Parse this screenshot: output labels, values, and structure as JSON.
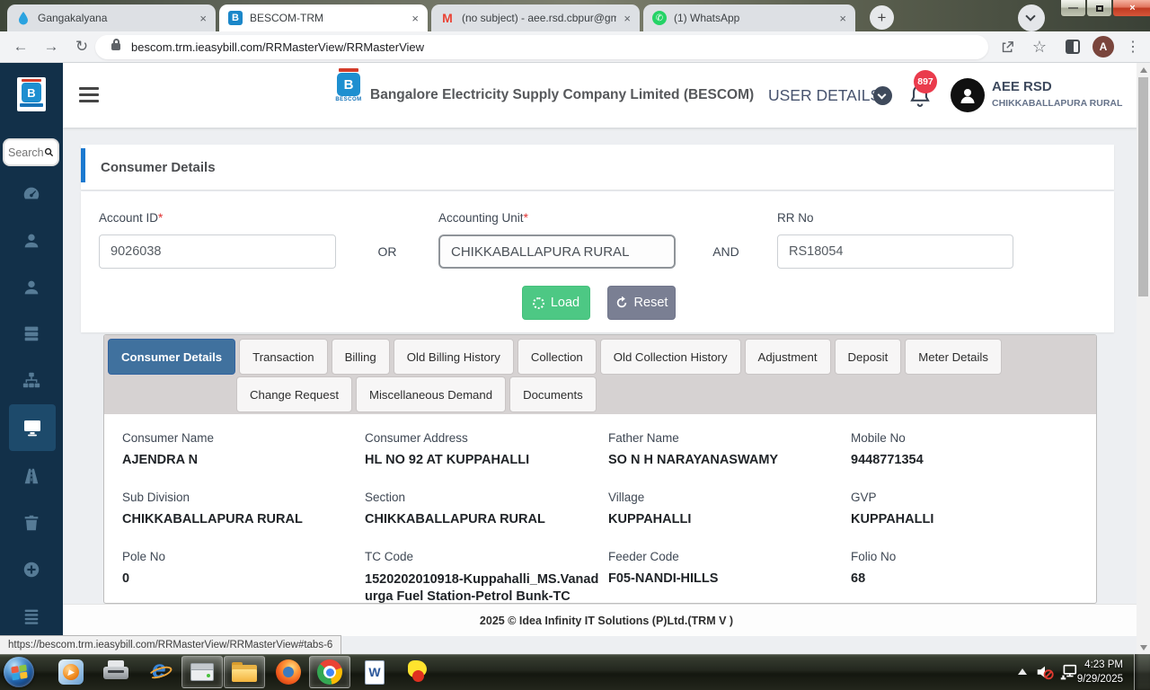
{
  "browser": {
    "tabs": [
      {
        "title": "Gangakalyana"
      },
      {
        "title": "BESCOM-TRM"
      },
      {
        "title": "(no subject) - aee.rsd.cbpur@gm"
      },
      {
        "title": "(1) WhatsApp"
      }
    ],
    "url": "bescom.trm.ieasybill.com/RRMasterView/RRMasterView",
    "profile_initial": "A"
  },
  "header": {
    "company_title": "Bangalore Electricity Supply Company Limited (BESCOM)",
    "logo_text": "BESCOM",
    "logo_letter": "B",
    "user_details_label": "USER DETAILS",
    "notification_count": "897",
    "user_name": "AEE RSD",
    "user_subtitle": "CHIKKABALLAPURA RURAL"
  },
  "sidebar": {
    "search_placeholder": "Search",
    "icons": [
      "dashboard",
      "user",
      "user",
      "server",
      "sitemap",
      "monitor",
      "road",
      "trash",
      "plus-circle",
      "list"
    ]
  },
  "page": {
    "title": "Consumer Details",
    "form": {
      "required_mark": "*",
      "account_id_label": "Account ID",
      "account_id_value": "9026038",
      "or_label": "OR",
      "accounting_unit_label": "Accounting Unit",
      "accounting_unit_value": "CHIKKABALLAPURA RURAL",
      "and_label": "AND",
      "rr_no_label": "RR No",
      "rr_no_value": "RS18054",
      "load_label": "Load",
      "reset_label": "Reset"
    },
    "tabs_row1": [
      "Consumer Details",
      "Transaction",
      "Billing",
      "Old Billing History",
      "Collection",
      "Old Collection History",
      "Adjustment",
      "Deposit",
      "Meter Details"
    ],
    "tabs_row2": [
      "Change Request",
      "Miscellaneous Demand",
      "Documents"
    ],
    "active_tab": "Consumer Details",
    "details": [
      {
        "label": "Consumer Name",
        "value": "AJENDRA N"
      },
      {
        "label": "Consumer Address",
        "value": "HL NO 92 AT KUPPAHALLI"
      },
      {
        "label": "Father Name",
        "value": "SO N H NARAYANASWAMY"
      },
      {
        "label": "Mobile No",
        "value": "9448771354"
      },
      {
        "label": "Sub Division",
        "value": "CHIKKABALLAPURA RURAL"
      },
      {
        "label": "Section",
        "value": "CHIKKABALLAPURA RURAL"
      },
      {
        "label": "Village",
        "value": "KUPPAHALLI"
      },
      {
        "label": "GVP",
        "value": "KUPPAHALLI"
      },
      {
        "label": "Pole No",
        "value": "0"
      },
      {
        "label": "TC Code",
        "value": "1520202010918-Kuppahalli_MS.Vanadurga Fuel Station-Petrol Bunk-TC"
      },
      {
        "label": "Feeder Code",
        "value": "F05-NANDI-HILLS"
      },
      {
        "label": "Folio No",
        "value": "68"
      }
    ],
    "footer": "2025 © Idea Infinity IT Solutions (P)Ltd.(TRM V )"
  },
  "status_bar": {
    "link_preview": "https://bescom.trm.ieasybill.com/RRMasterView/RRMasterView#tabs-6"
  },
  "taskbar": {
    "time": "4:23 PM",
    "date": "9/29/2025"
  },
  "colors": {
    "accent_blue": "#1b79d0",
    "active_tab_blue": "#40719e",
    "load_green": "#4dc884",
    "reset_gray": "#7a7f93",
    "badge_red": "#ea3b4c",
    "sidebar_navy": "#123049"
  }
}
